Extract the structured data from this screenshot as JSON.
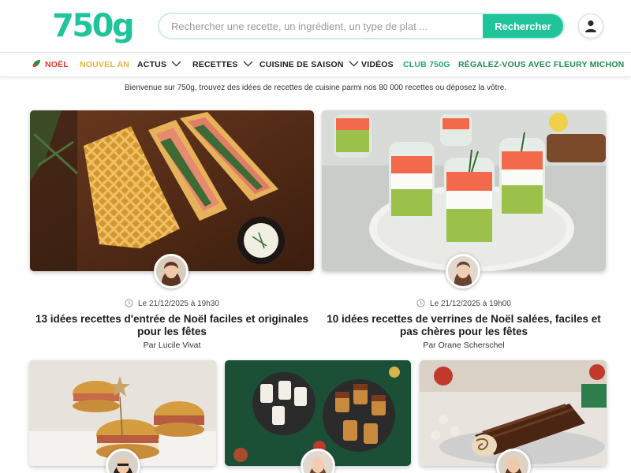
{
  "header": {
    "logo": "750g",
    "search": {
      "placeholder": "Rechercher une recette, un ingrédient, un type de plat ...",
      "value": ""
    },
    "search_button": "Rechercher",
    "account_icon": "user-icon"
  },
  "nav": {
    "items": [
      {
        "label": "NOËL",
        "color": "#e03b2e",
        "icon": "holly-leaf-icon"
      },
      {
        "label": "NOUVEL AN",
        "color": "#e8b33a"
      },
      {
        "label": "ACTUS",
        "dropdown": true
      },
      {
        "label": "RECETTES",
        "dropdown": true
      },
      {
        "label": "CUISINE DE SAISON",
        "dropdown": true
      },
      {
        "label": "VIDÉOS"
      },
      {
        "label": "CLUB 750G",
        "color": "#1fa77f"
      },
      {
        "label": "RÉGALEZ-VOUS AVEC FLEURY MICHON",
        "color": "#1f8a4c"
      }
    ]
  },
  "welcome": "Bienvenue sur 750g, trouvez des idées de recettes de cuisine parmi nos 80 000 recettes ou déposez la vôtre.",
  "featured": [
    {
      "date": "Le 21/12/2025 à 19h30",
      "title": "13 idées recettes d'entrée de Noël faciles et originales pour les fêtes",
      "author": "Par Lucile Vivat",
      "image": "salmon-puff-pastry-photo"
    },
    {
      "date": "Le 21/12/2025 à 19h00",
      "title": "10 idées recettes de verrines de Noël salées, faciles et pas chères pour les fêtes",
      "author": "Par Orane Scherschel",
      "image": "salmon-verrines-photo"
    }
  ],
  "secondary": [
    {
      "image": "mini-burgers-photo"
    },
    {
      "image": "festive-verrines-table-photo"
    },
    {
      "image": "yule-log-photo"
    }
  ],
  "colors": {
    "brand": "#1fc49a",
    "noel": "#e03b2e",
    "nouvel_an": "#e8b33a",
    "club": "#1fa77f",
    "fleury": "#1f8a4c"
  }
}
